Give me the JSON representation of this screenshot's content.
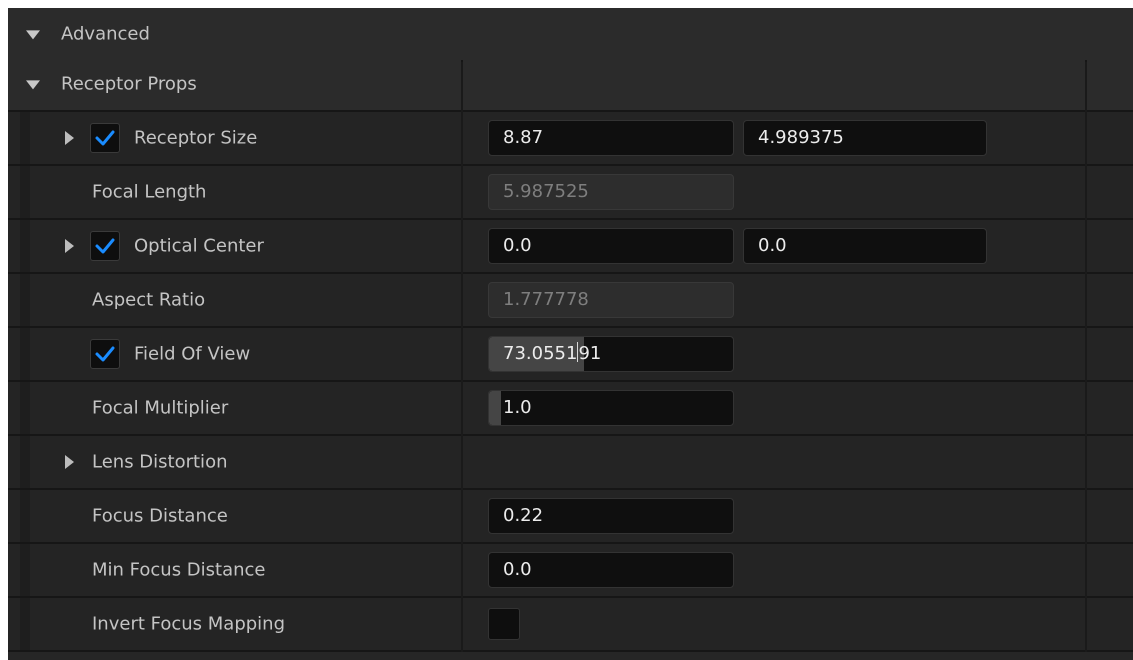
{
  "sections": {
    "advanced": "Advanced",
    "receptor_props": "Receptor Props"
  },
  "colors": {
    "accent": "#1a8cff",
    "panel_bg": "#1a1a1a",
    "row_bg": "#242424",
    "field_bg": "#0f0f0f"
  },
  "rows": {
    "receptor_size": {
      "label": "Receptor Size",
      "checked": true,
      "x": "8.87",
      "y": "4.989375"
    },
    "focal_length": {
      "label": "Focal Length",
      "value": "5.987525"
    },
    "optical_center": {
      "label": "Optical Center",
      "checked": true,
      "x": "0.0",
      "y": "0.0"
    },
    "aspect_ratio": {
      "label": "Aspect Ratio",
      "value": "1.777778"
    },
    "field_of_view": {
      "label": "Field Of View",
      "checked": true,
      "value": "73.055191",
      "value_head": "73.0551",
      "value_tail": "91",
      "slider_fraction": 0.39
    },
    "focal_multiplier": {
      "label": "Focal Multiplier",
      "value": "1.0",
      "slider_fraction": 0.0
    },
    "lens_distortion": {
      "label": "Lens Distortion"
    },
    "focus_distance": {
      "label": "Focus Distance",
      "value": "0.22"
    },
    "min_focus_distance": {
      "label": "Min Focus Distance",
      "value": "0.0"
    },
    "invert_focus_mapping": {
      "label": "Invert Focus Mapping",
      "checked": false
    }
  }
}
